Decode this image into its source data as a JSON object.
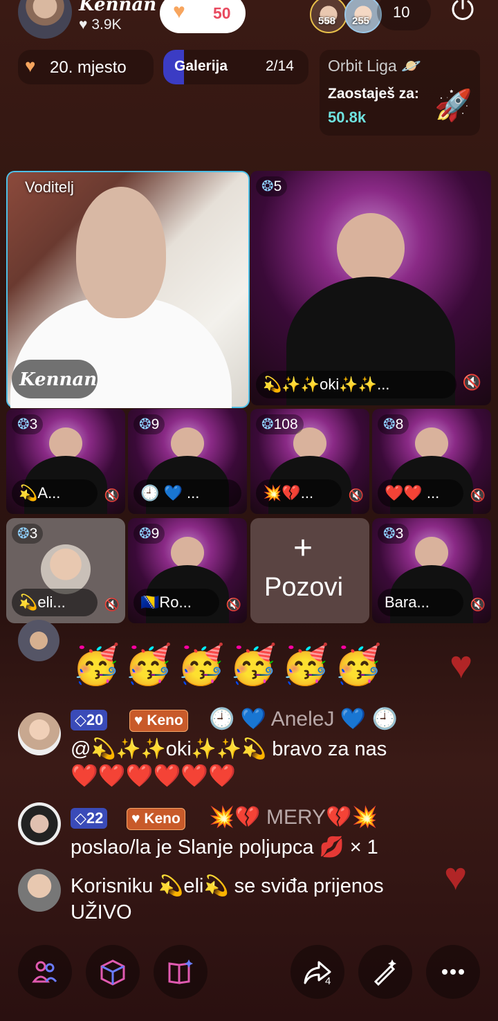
{
  "header": {
    "host_name": "Kennan",
    "host_likes": "3.9K",
    "follow_count": "50",
    "viewer_badges": [
      "558",
      "255"
    ],
    "viewer_count": "10"
  },
  "stats": {
    "rank_label": "20. mjesto",
    "gallery_label": "Galerija",
    "gallery_count": "2/14",
    "orbit_title": "Orbit Liga",
    "orbit_sub": "Zaostaješ za:",
    "orbit_value": "50.8k"
  },
  "host_video": {
    "role_label": "Voditelj",
    "name": "Kennan"
  },
  "tiles": [
    {
      "badge": "5",
      "name": "💫✨✨oki✨✨..."
    },
    {
      "badge": "3",
      "name": "💫A..."
    },
    {
      "badge": "9",
      "name": "🕘 💙 ..."
    },
    {
      "badge": "108",
      "name": "💥💔..."
    },
    {
      "badge": "8",
      "name": "❤️❤️ ..."
    },
    {
      "badge": "3",
      "name": "💫eli..."
    },
    {
      "badge": "9",
      "name": "🇧🇦Ro..."
    },
    {
      "badge": "3",
      "name": "Bara..."
    }
  ],
  "invite_label": "Pozovi",
  "chat": {
    "emoji_row": "🥳🥳🥳🥳🥳🥳",
    "msg1": {
      "level": "20",
      "fan": "Keno",
      "user": "🕘 💙 AneleJ 💙 🕘",
      "text": "@💫✨✨oki✨✨💫 bravo za nas",
      "hearts": "❤️❤️❤️❤️❤️❤️"
    },
    "msg2": {
      "level": "22",
      "fan": "Keno",
      "user": "💥💔 MERY💔💥",
      "text": "poslao/la je Slanje poljupca 💋 × 1"
    },
    "msg3": {
      "text": "Korisniku 💫eli💫 se sviđa prijenos",
      "text2": "UŽIVO"
    }
  },
  "toolbar": {
    "share_count": "4"
  },
  "colors": {
    "accent_cyan": "#6fe3e0",
    "level_badge": "#3a4bb8",
    "fan_badge": "#c85a2a"
  }
}
